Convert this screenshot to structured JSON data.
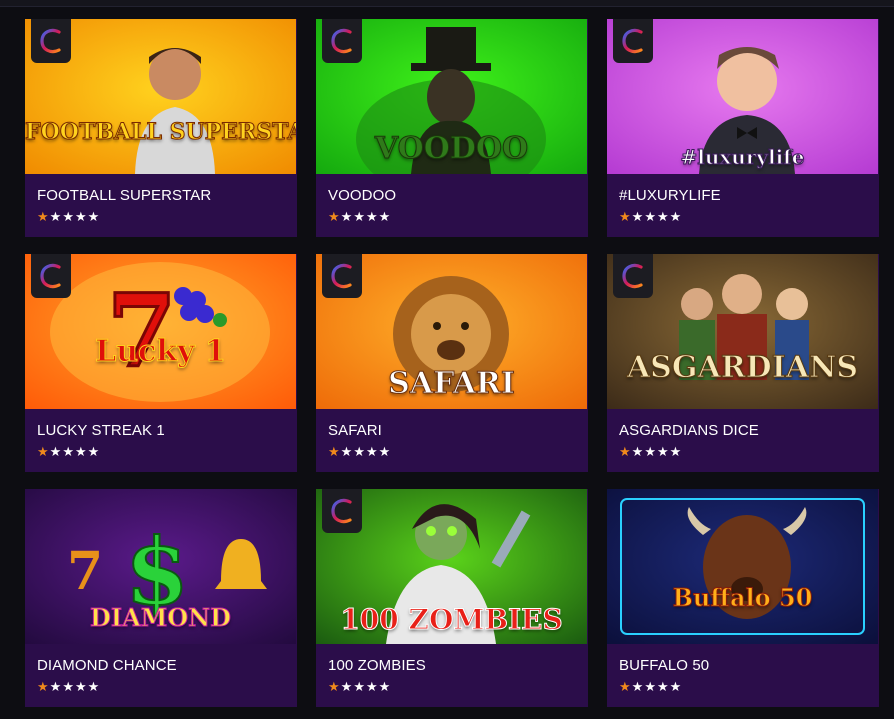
{
  "games": [
    {
      "title": "FOOTBALL SUPERSTAR",
      "logo": "FOOTBALL SUPERSTAR",
      "rating": 1,
      "bg": [
        "#ffd21e",
        "#f08a00"
      ],
      "accent": "#ffef5a"
    },
    {
      "title": "VOODOO",
      "logo": "VOODOO",
      "rating": 1,
      "bg": [
        "#3ff21a",
        "#14a80e"
      ],
      "accent": "#2f7a1a"
    },
    {
      "title": "#LUXURYLIFE",
      "logo": "#luxurylife",
      "rating": 1,
      "bg": [
        "#e77aef",
        "#b43ad2"
      ],
      "accent": "#ffffff"
    },
    {
      "title": "LUCKY STREAK 1",
      "logo": "Lucky 1",
      "rating": 1,
      "bg": [
        "#ffa62a",
        "#ff5a08"
      ],
      "accent": "#d60a0a"
    },
    {
      "title": "SAFARI",
      "logo": "SAFARI",
      "rating": 1,
      "bg": [
        "#ffb02a",
        "#ee6a08"
      ],
      "accent": "#ffffff"
    },
    {
      "title": "ASGARDIANS DICE",
      "logo": "ASGARDIANS",
      "rating": 1,
      "bg": [
        "#8a6a36",
        "#3b2a18"
      ],
      "accent": "#f7e7b8"
    },
    {
      "title": "DIAMOND CHANCE",
      "logo": "DIAMOND",
      "rating": 1,
      "bg": [
        "#5a1a8a",
        "#220a3e"
      ],
      "accent": "#28d23a"
    },
    {
      "title": "100 ZOMBIES",
      "logo": "100 ZOMBIES",
      "rating": 1,
      "bg": [
        "#5ad21a",
        "#1a5a10"
      ],
      "accent": "#e82018"
    },
    {
      "title": "BUFFALO 50",
      "logo": "Buffalo 50",
      "rating": 1,
      "bg": [
        "#1d2a78",
        "#0b0f3a"
      ],
      "accent": "#ff5a18"
    }
  ],
  "colors": {
    "card_background": "#2b0d4a",
    "page_background": "#0d0d12",
    "star_filled": "#f08a1c",
    "star_empty": "#ffffff"
  },
  "icons": {
    "provider_badge": "endorphina-e-icon",
    "rating_star": "star-icon"
  }
}
